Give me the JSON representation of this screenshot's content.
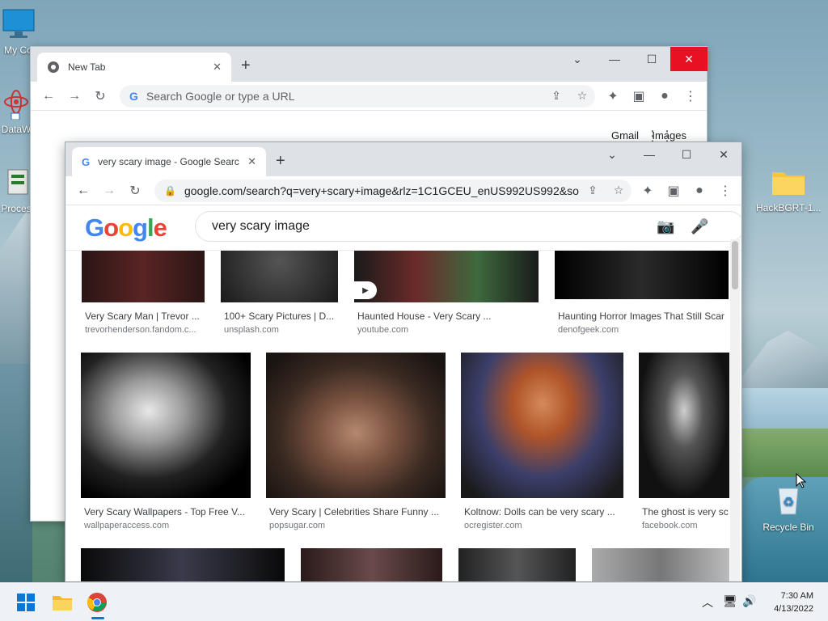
{
  "desktop": {
    "icons": [
      {
        "name": "my-computer",
        "label": "My Co"
      },
      {
        "name": "datawrapper",
        "label": "DataW"
      },
      {
        "name": "process",
        "label": "Proces"
      },
      {
        "name": "hackbgrt-folder",
        "label": "HackBGRT-1..."
      },
      {
        "name": "recycle-bin",
        "label": "Recycle Bin"
      }
    ]
  },
  "back_window": {
    "tab_title": "New Tab",
    "omnibox_placeholder": "Search Google or type a URL",
    "links": {
      "gmail": "Gmail",
      "images": "Images"
    }
  },
  "front_window": {
    "tab_title": "very scary image - Google Search",
    "url": "google.com/search?q=very+scary+image&rlz=1C1GCEU_enUS992US992&so...",
    "logo": "Google",
    "query": "very scary image",
    "results_row1": [
      {
        "title": "Very Scary Man | Trevor ...",
        "source": "trevorhenderson.fandom.c..."
      },
      {
        "title": "100+ Scary Pictures | D...",
        "source": "unsplash.com"
      },
      {
        "title": "Haunted House - Very Scary ...",
        "source": "youtube.com"
      },
      {
        "title": "Haunting Horror Images That Still Scar",
        "source": "denofgeek.com"
      }
    ],
    "results_row2": [
      {
        "title": "Very Scary Wallpapers - Top Free V...",
        "source": "wallpaperaccess.com"
      },
      {
        "title": "Very Scary | Celebrities Share Funny ...",
        "source": "popsugar.com"
      },
      {
        "title": "Koltnow: Dolls can be very scary ...",
        "source": "ocregister.com"
      },
      {
        "title": "The ghost is very sc",
        "source": "facebook.com"
      }
    ]
  },
  "taskbar": {
    "time": "7:30 AM",
    "date": "4/13/2022"
  },
  "colors": {
    "google_blue": "#4285f4",
    "google_red": "#ea4335",
    "google_yellow": "#fbbc05",
    "google_green": "#34a853",
    "close_red": "#e81123"
  }
}
